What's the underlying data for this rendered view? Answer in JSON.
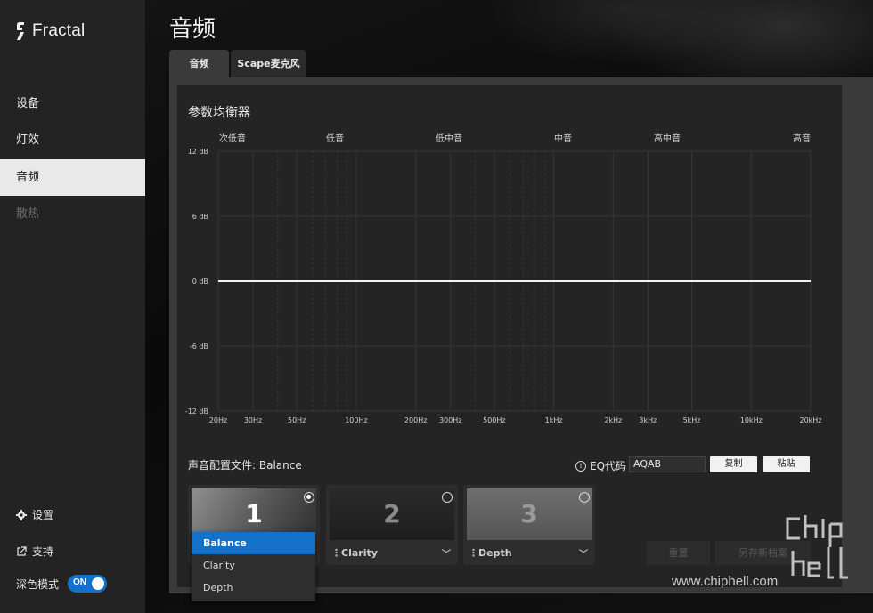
{
  "brand": {
    "logo_text": "Fractal"
  },
  "sidebar": {
    "items": [
      {
        "label": "设备"
      },
      {
        "label": "灯效"
      },
      {
        "label": "音频"
      },
      {
        "label": "散热"
      }
    ],
    "settings_label": "设置",
    "support_label": "支持",
    "dark_mode_label": "深色模式",
    "dark_mode_state": "ON"
  },
  "page": {
    "title": "音频",
    "tabs": [
      {
        "label": "音频"
      },
      {
        "label": "Scape麦克风"
      }
    ]
  },
  "eq": {
    "title": "参数均衡器",
    "bands": [
      "次低音",
      "低音",
      "低中音",
      "中音",
      "高中音",
      "高音"
    ],
    "y_ticks": [
      "12 dB",
      "6 dB",
      "0 dB",
      "-6 dB",
      "-12 dB"
    ],
    "x_ticks": [
      "20Hz",
      "30Hz",
      "50Hz",
      "100Hz",
      "200Hz",
      "300Hz",
      "500Hz",
      "1kHz",
      "2kHz",
      "3kHz",
      "5kHz",
      "10kHz",
      "20kHz"
    ]
  },
  "chart_data": {
    "type": "line",
    "title": "参数均衡器",
    "xlabel": "",
    "ylabel": "",
    "x_scale": "log",
    "x_range_hz": [
      20,
      20000
    ],
    "ylim": [
      -12,
      12
    ],
    "x": [
      20,
      20000
    ],
    "y": [
      0,
      0
    ],
    "grid": true
  },
  "profile": {
    "label": "声音配置文件: Balance",
    "eq_code_label": "EQ代码",
    "eq_code_value": "AQAB",
    "copy_label": "复制",
    "paste_label": "粘贴",
    "cards": [
      {
        "number": "1",
        "name": "Balance",
        "selected": true
      },
      {
        "number": "2",
        "name": "Clarity",
        "selected": false
      },
      {
        "number": "3",
        "name": "Depth",
        "selected": false
      }
    ],
    "dropdown_options": [
      "Balance",
      "Clarity",
      "Depth"
    ],
    "reset_label": "重置",
    "save_new_label": "另存新档案"
  },
  "watermark": {
    "text": "www.chiphell.com"
  },
  "colors": {
    "accent": "#1471c9",
    "sidebar_bg": "#232323",
    "panel_bg": "#242424"
  }
}
